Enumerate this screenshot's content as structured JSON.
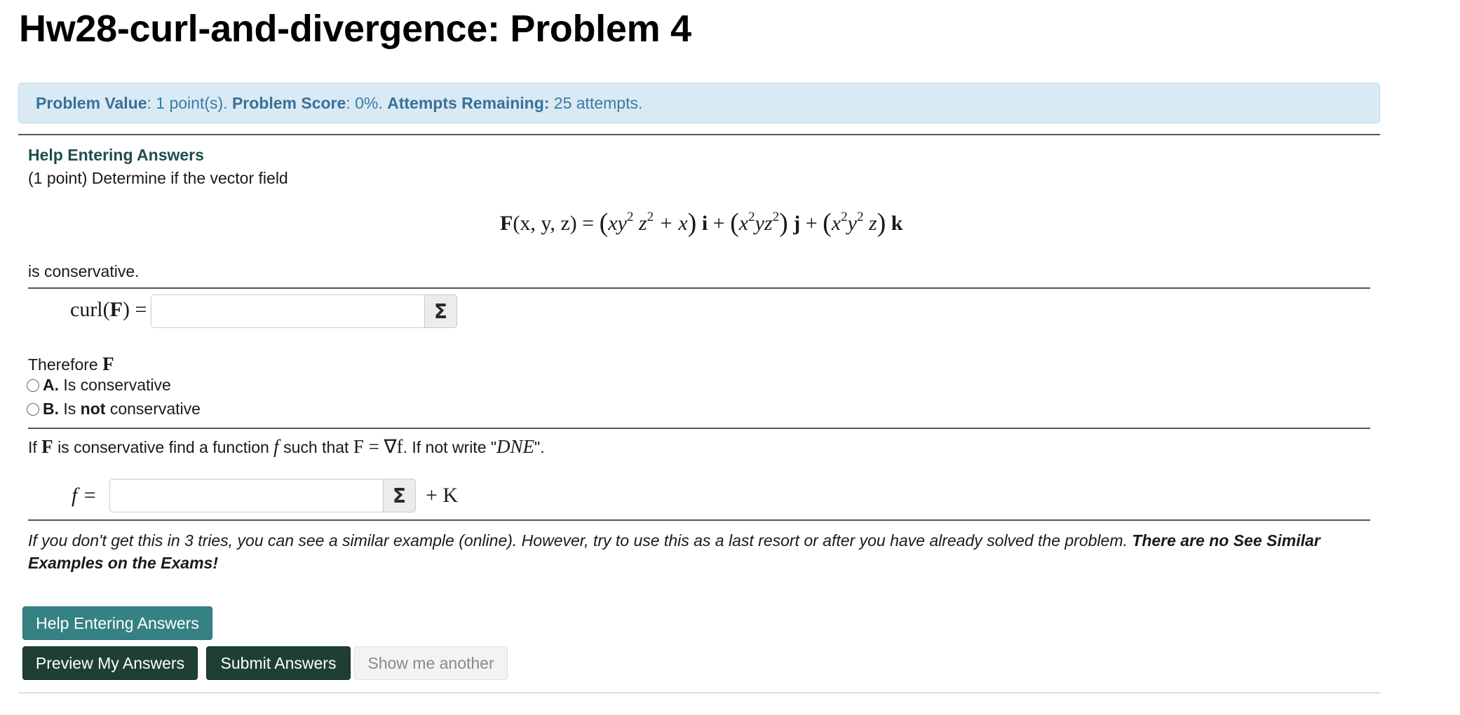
{
  "page": {
    "title": "Hw28-curl-and-divergence: Problem 4"
  },
  "score_bar": {
    "value_label": "Problem Value",
    "value_text": ": 1 point(s).",
    "score_label": "Problem Score",
    "score_text": ": 0%.",
    "attempts_label": "Attempts Remaining:",
    "attempts_text": "25 attempts."
  },
  "problem": {
    "help_link": "Help Entering Answers",
    "intro": "(1 point) Determine if the vector field",
    "equation": {
      "F": "F",
      "args": "(x, y, z) =",
      "i_comp_a": "xy",
      "i_comp_b": "z",
      "i_comp_c": "+ x",
      "i": "i",
      "j_comp_a": "x",
      "j_comp_b": "yz",
      "j": "j",
      "k_comp_a": "x",
      "k_comp_b": "y",
      "k_comp_c": "z",
      "k": "k",
      "exp": "2",
      "plus": "+"
    },
    "is_conservative": "is conservative.",
    "curl_label_pre": "curl(",
    "curl_label_F": "F",
    "curl_label_post": ") =",
    "curl_value": "",
    "therefore": "Therefore",
    "therefore_F": "F",
    "options": [
      {
        "letter": "A.",
        "text_pre": "Is conservative",
        "bold": "",
        "text_post": ""
      },
      {
        "letter": "B.",
        "text_pre": "Is",
        "bold": "not",
        "text_post": "conservative"
      }
    ],
    "q2_if": "If",
    "q2_F": "F",
    "q2_mid": "is conservative find a function",
    "q2_f": "f",
    "q2_such": "such that",
    "q2_eq": "F = ∇f",
    "q2_end": ". If not write \"",
    "q2_dne": "DNE",
    "q2_close": "\".",
    "f_label": "f =",
    "f_value": "",
    "plus_k": "+ K",
    "footnote_normal": "If you don't get this in 3 tries, you can see a similar example (online). However, try to use this as a last resort or after you have already solved the problem.",
    "footnote_bold": "There are no See Similar Examples on the Exams!",
    "sigma": "Σ"
  },
  "buttons": {
    "help": "Help Entering Answers",
    "preview": "Preview My Answers",
    "submit": "Submit Answers",
    "another": "Show me another"
  }
}
